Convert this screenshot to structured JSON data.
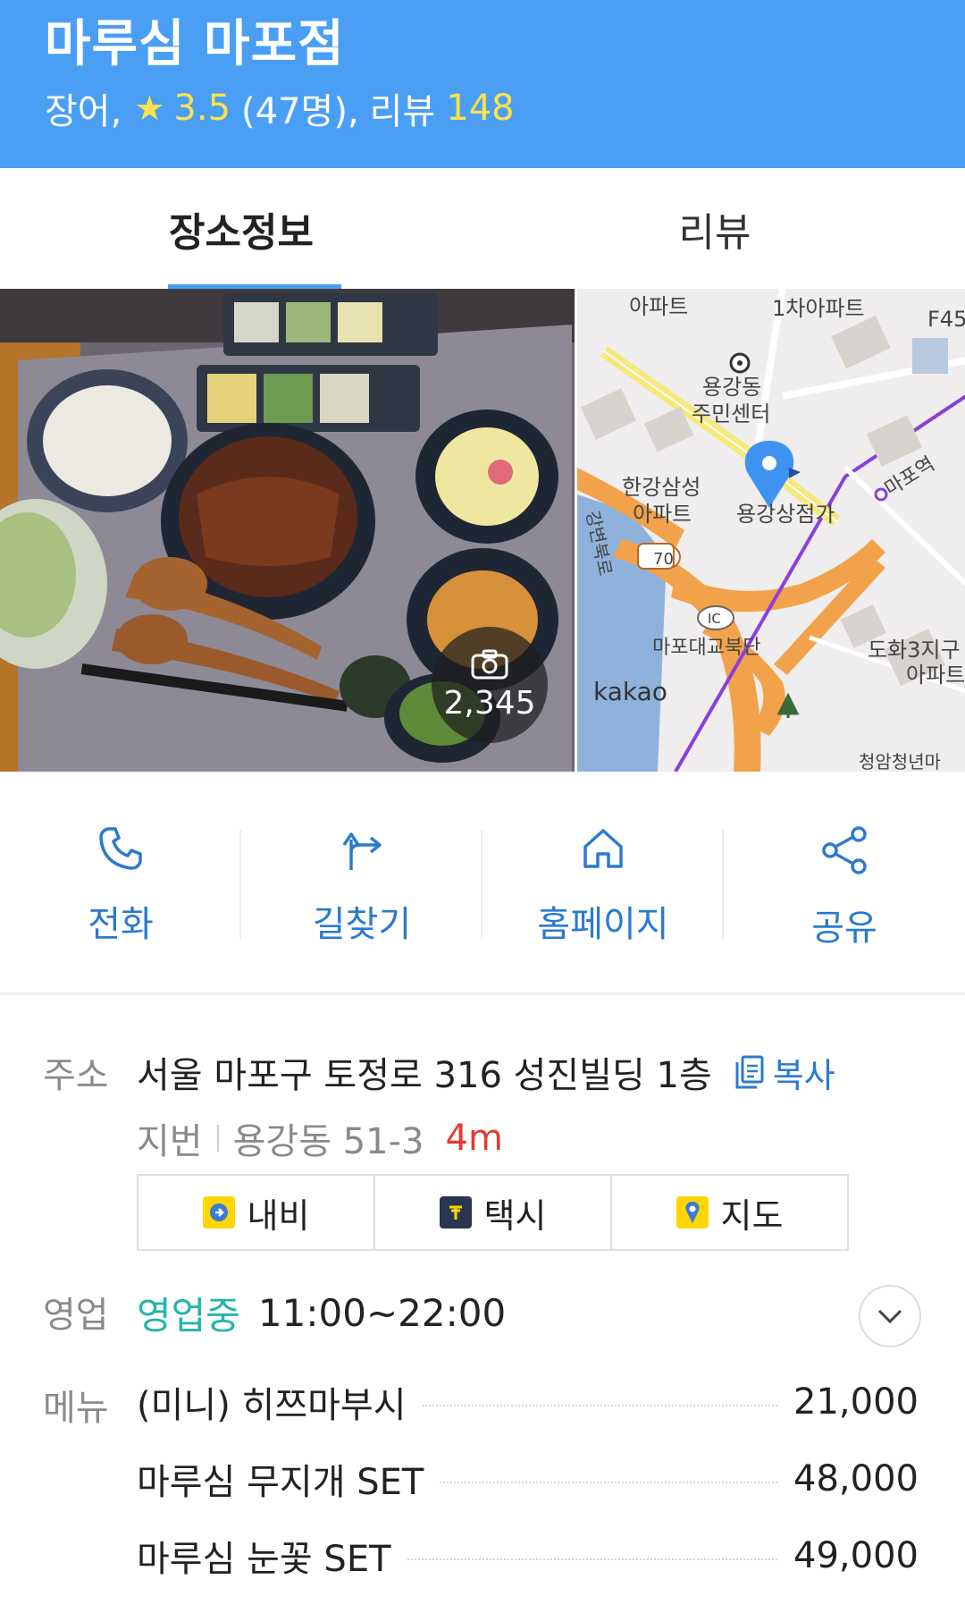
{
  "header": {
    "title": "마루심 마포점",
    "category": "장어,",
    "rating": "3.5",
    "rating_count": "(47명),",
    "review_label": "리뷰",
    "review_count": "148"
  },
  "tabs": [
    {
      "label": "장소정보",
      "active": true
    },
    {
      "label": "리뷰",
      "active": false
    }
  ],
  "photo": {
    "count": "2,345"
  },
  "map": {
    "labels": {
      "apt1": "아파트",
      "apt2": "1차아파트",
      "f45": "F45",
      "center1": "용강동",
      "center2": "주민센터",
      "hangang1": "한강삼성",
      "hangang2": "아파트",
      "shop": "용강상점가",
      "station": "마포역",
      "road": "강변북로",
      "route": "70",
      "ic": "IC",
      "bridge": "마포대교북단",
      "dohwa1": "도화3지구",
      "dohwa2": "아파트",
      "bottom": "청암청년마",
      "brand": "kakao"
    }
  },
  "actions": [
    {
      "label": "전화",
      "icon": "phone-icon"
    },
    {
      "label": "길찾기",
      "icon": "directions-icon"
    },
    {
      "label": "홈페이지",
      "icon": "home-icon"
    },
    {
      "label": "공유",
      "icon": "share-icon"
    }
  ],
  "address": {
    "label": "주소",
    "value": "서울 마포구 토정로 316 성진빌딩 1층",
    "copy_label": "복사",
    "jibun_label": "지번",
    "jibun_value": "용강동 51-3",
    "distance": "4m"
  },
  "nav_buttons": [
    {
      "label": "내비",
      "icon": "navi-icon",
      "color": "#ffd600"
    },
    {
      "label": "택시",
      "icon": "taxi-icon",
      "color": "#2c3550"
    },
    {
      "label": "지도",
      "icon": "map-pin-icon",
      "color": "#ffd600"
    }
  ],
  "hours": {
    "label": "영업",
    "status": "영업중",
    "time": "11:00~22:00"
  },
  "menu": {
    "label": "메뉴",
    "items": [
      {
        "name": "(미니) 히쯔마부시",
        "price": "21,000"
      },
      {
        "name": "마루심 무지개 SET",
        "price": "48,000"
      },
      {
        "name": "마루심 눈꽃 SET",
        "price": "49,000"
      }
    ]
  },
  "colors": {
    "header_bg": "#4a9ff5",
    "accent_blue": "#2a7ad0",
    "open_green": "#21b6a8",
    "distance_red": "#e53935",
    "rating_yellow": "#ffe14a"
  }
}
